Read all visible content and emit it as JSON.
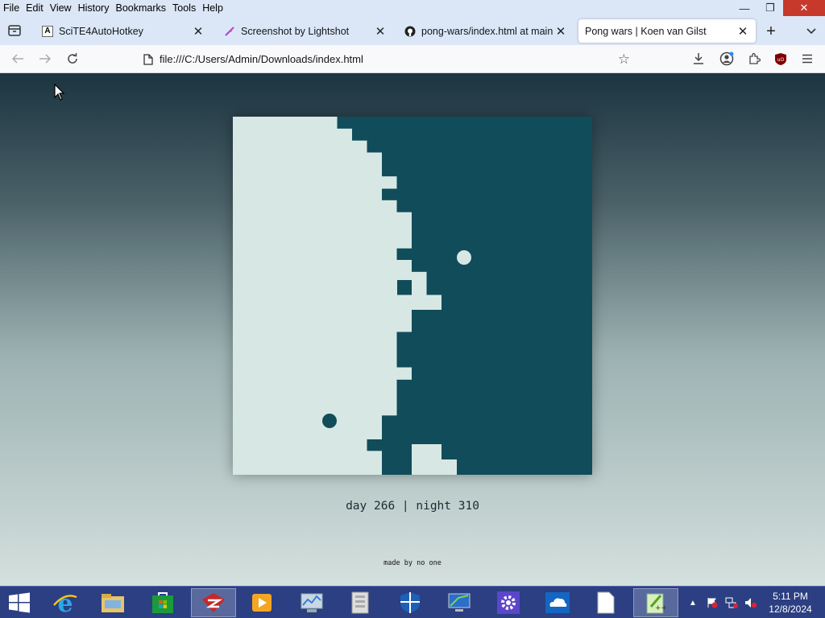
{
  "menu": [
    "File",
    "Edit",
    "View",
    "History",
    "Bookmarks",
    "Tools",
    "Help"
  ],
  "window_controls": {
    "minimize": "—",
    "restore": "❐",
    "close": "✕"
  },
  "tabs": [
    {
      "title": "SciTE4AutoHotkey",
      "favicon": "A"
    },
    {
      "title": "Screenshot by Lightshot",
      "favicon": "feather"
    },
    {
      "title": "pong-wars/index.html at main",
      "favicon": "github"
    },
    {
      "title": "Pong wars | Koen van Gilst",
      "favicon": ""
    }
  ],
  "new_tab": "+",
  "address": {
    "url": "file:///C:/Users/Admin/Downloads/index.html"
  },
  "page": {
    "score": "day 266 | night 310",
    "credit": "made by no one"
  },
  "colors": {
    "day": "#d7e8e4",
    "night": "#114c5a"
  },
  "taskbar": {
    "apps": [
      "internet-explorer",
      "file-explorer",
      "store",
      "filezilla",
      "media-player",
      "performance-monitor",
      "file-archive",
      "defender",
      "remote-desktop",
      "settings",
      "onedrive",
      "notepad",
      "notepad-plus-plus"
    ],
    "clock": {
      "time": "5:11 PM",
      "date": "12/8/2024"
    }
  }
}
